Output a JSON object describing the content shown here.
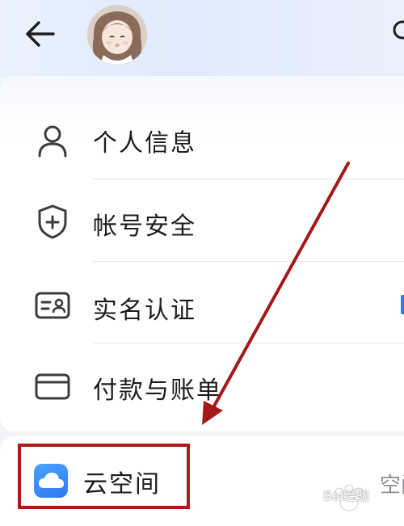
{
  "header": {
    "back_icon": "back-arrow-icon",
    "avatar": "user-avatar",
    "top_right_icon": "partial-icon"
  },
  "menu": {
    "items": [
      {
        "label": "个人信息",
        "icon": "person-icon"
      },
      {
        "label": "帐号安全",
        "icon": "shield-plus-icon"
      },
      {
        "label": "实名认证",
        "icon": "id-card-icon"
      },
      {
        "label": "付款与账单",
        "icon": "card-icon"
      }
    ]
  },
  "cloud": {
    "label": "云空间",
    "icon": "cloud-icon",
    "trailing_text": "空间"
  },
  "annotation": {
    "color": "#b0191a"
  },
  "watermark": {
    "text": "Bai经验"
  }
}
